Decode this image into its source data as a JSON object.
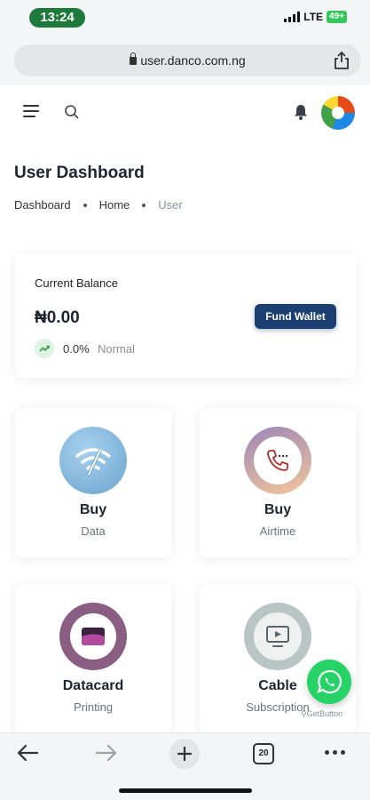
{
  "status_bar": {
    "time": "13:24",
    "network": "LTE",
    "battery": "49+"
  },
  "browser": {
    "url": "user.danco.com.ng",
    "tab_count": "20"
  },
  "header": {
    "menu_icon": "hamburger-menu-icon",
    "search_icon": "search-icon",
    "notification_icon": "bell-icon"
  },
  "page": {
    "title": "User Dashboard",
    "breadcrumb": [
      "Dashboard",
      "Home",
      "User"
    ]
  },
  "balance": {
    "label": "Current Balance",
    "amount": "₦0.00",
    "fund_button": "Fund Wallet",
    "trend_percent": "0.0%",
    "trend_status": "Normal"
  },
  "services": [
    {
      "title": "Buy",
      "subtitle": "Data",
      "icon": "wifi-icon"
    },
    {
      "title": "Buy",
      "subtitle": "Airtime",
      "icon": "phone-call-icon"
    },
    {
      "title": "Datacard",
      "subtitle": "Printing",
      "icon": "card-icon"
    },
    {
      "title": "Cable",
      "subtitle": "Subscription",
      "icon": "tv-icon"
    }
  ],
  "whatsapp": {
    "label": "GetButton"
  },
  "colors": {
    "accent": "#1c3f72",
    "time_pill": "#1d7a3a",
    "whatsapp": "#25d366"
  }
}
